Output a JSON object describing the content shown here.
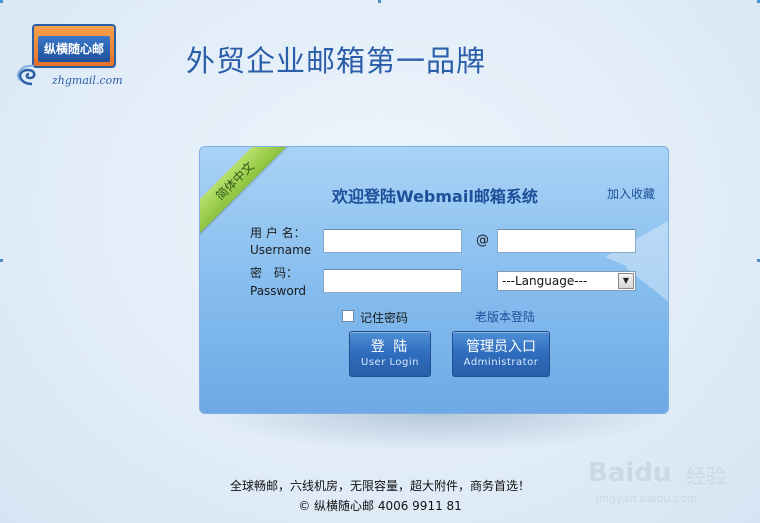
{
  "header": {
    "logo_text": "纵横随心邮",
    "logo_domain": "zhgmail.com",
    "slogan": "外贸企业邮箱第一品牌"
  },
  "panel": {
    "ribbon": "简体中文",
    "title": "欢迎登陆Webmail邮箱系统",
    "bookmark": "加入收藏",
    "username_label_cn": "用 户 名：",
    "username_label_en": "Username",
    "username_value": "",
    "at_sign": "@",
    "domain_value": "",
    "password_label_cn": "密　码：",
    "password_label_en": "Password",
    "password_value": "",
    "language_selected": "---Language---",
    "remember_label": "记住密码",
    "old_version_link": "老版本登陆",
    "login_button": "登 陆",
    "login_button_sub": "User Login",
    "admin_button": "管理员入口",
    "admin_button_sub": "Administrator"
  },
  "footer": {
    "line1": "全球畅邮，六线机房，无限容量，超大附件，商务首选！",
    "line2": "© 纵横随心邮 4006 9911 81"
  },
  "watermark": {
    "brand": "Baidu",
    "label": "经验",
    "url": "jingyan.baidu.com"
  },
  "colors": {
    "accent": "#2b5ea8",
    "panel": "#84bcee",
    "button": "#2f6cbd",
    "ribbon": "#a6d456"
  }
}
